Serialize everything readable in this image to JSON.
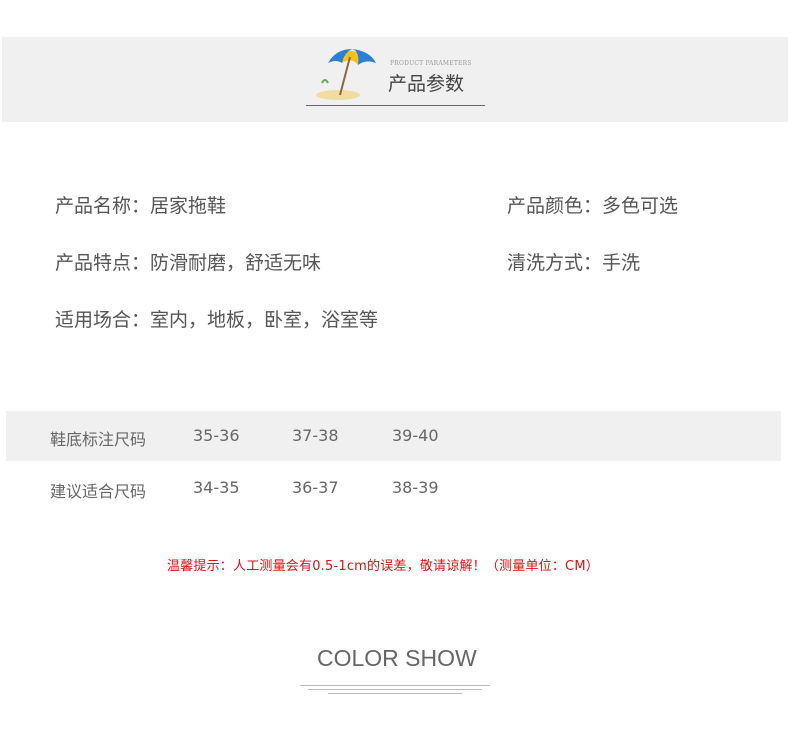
{
  "header": {
    "small_caption": "PRODUCT PARAMETERS",
    "title": "产品参数",
    "icon": "beach-umbrella-icon"
  },
  "params": {
    "name": "产品名称：居家拖鞋",
    "color": "产品颜色：多色可选",
    "feature": "产品特点：防滑耐磨，舒适无味",
    "wash": "清洗方式：手洗",
    "usage": "适用场合：室内，地板，卧室，浴室等"
  },
  "size_table": {
    "rows": [
      {
        "label": "鞋底标注尺码",
        "values": [
          "35-36",
          "37-38",
          "39-40"
        ]
      },
      {
        "label": "建议适合尺码",
        "values": [
          "34-35",
          "36-37",
          "38-39"
        ]
      }
    ]
  },
  "notice": "温馨提示：人工测量会有0.5-1cm的误差，敬请谅解！（测量单位：CM）",
  "color_show": {
    "title": "COLOR SHOW"
  },
  "colors": {
    "band": "#f0f0f0",
    "notice": "#dd1111",
    "text": "#555555"
  }
}
